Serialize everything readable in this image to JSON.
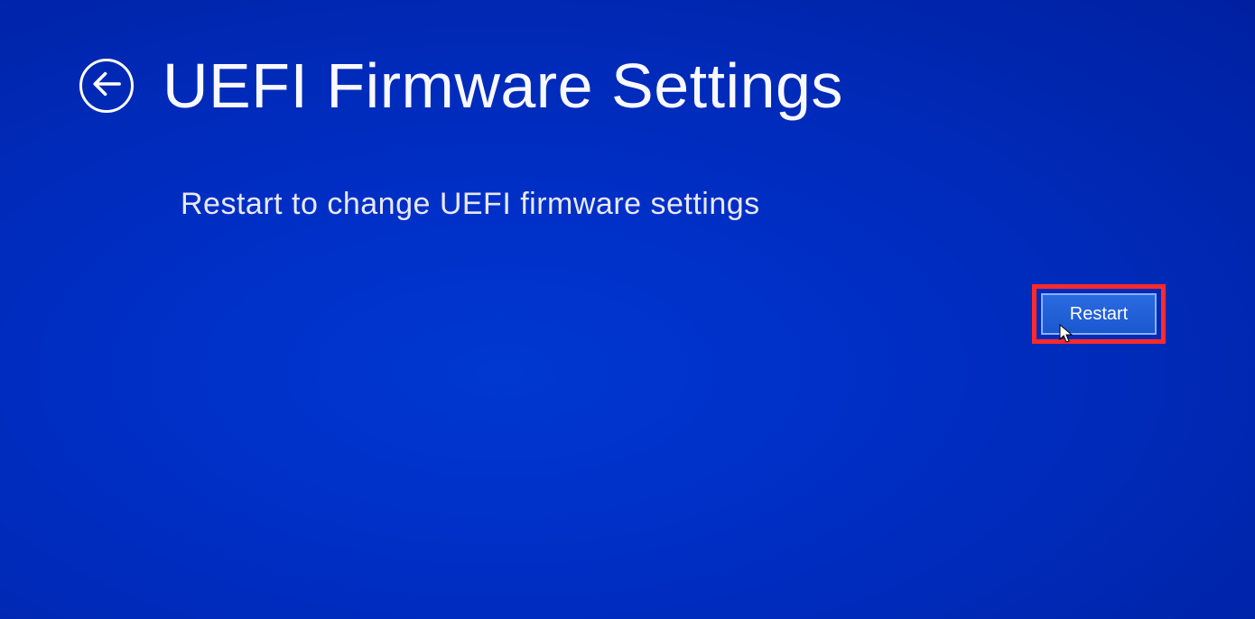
{
  "header": {
    "title": "UEFI Firmware Settings"
  },
  "body": {
    "subtitle": "Restart to change UEFI firmware settings"
  },
  "actions": {
    "restart_label": "Restart"
  }
}
